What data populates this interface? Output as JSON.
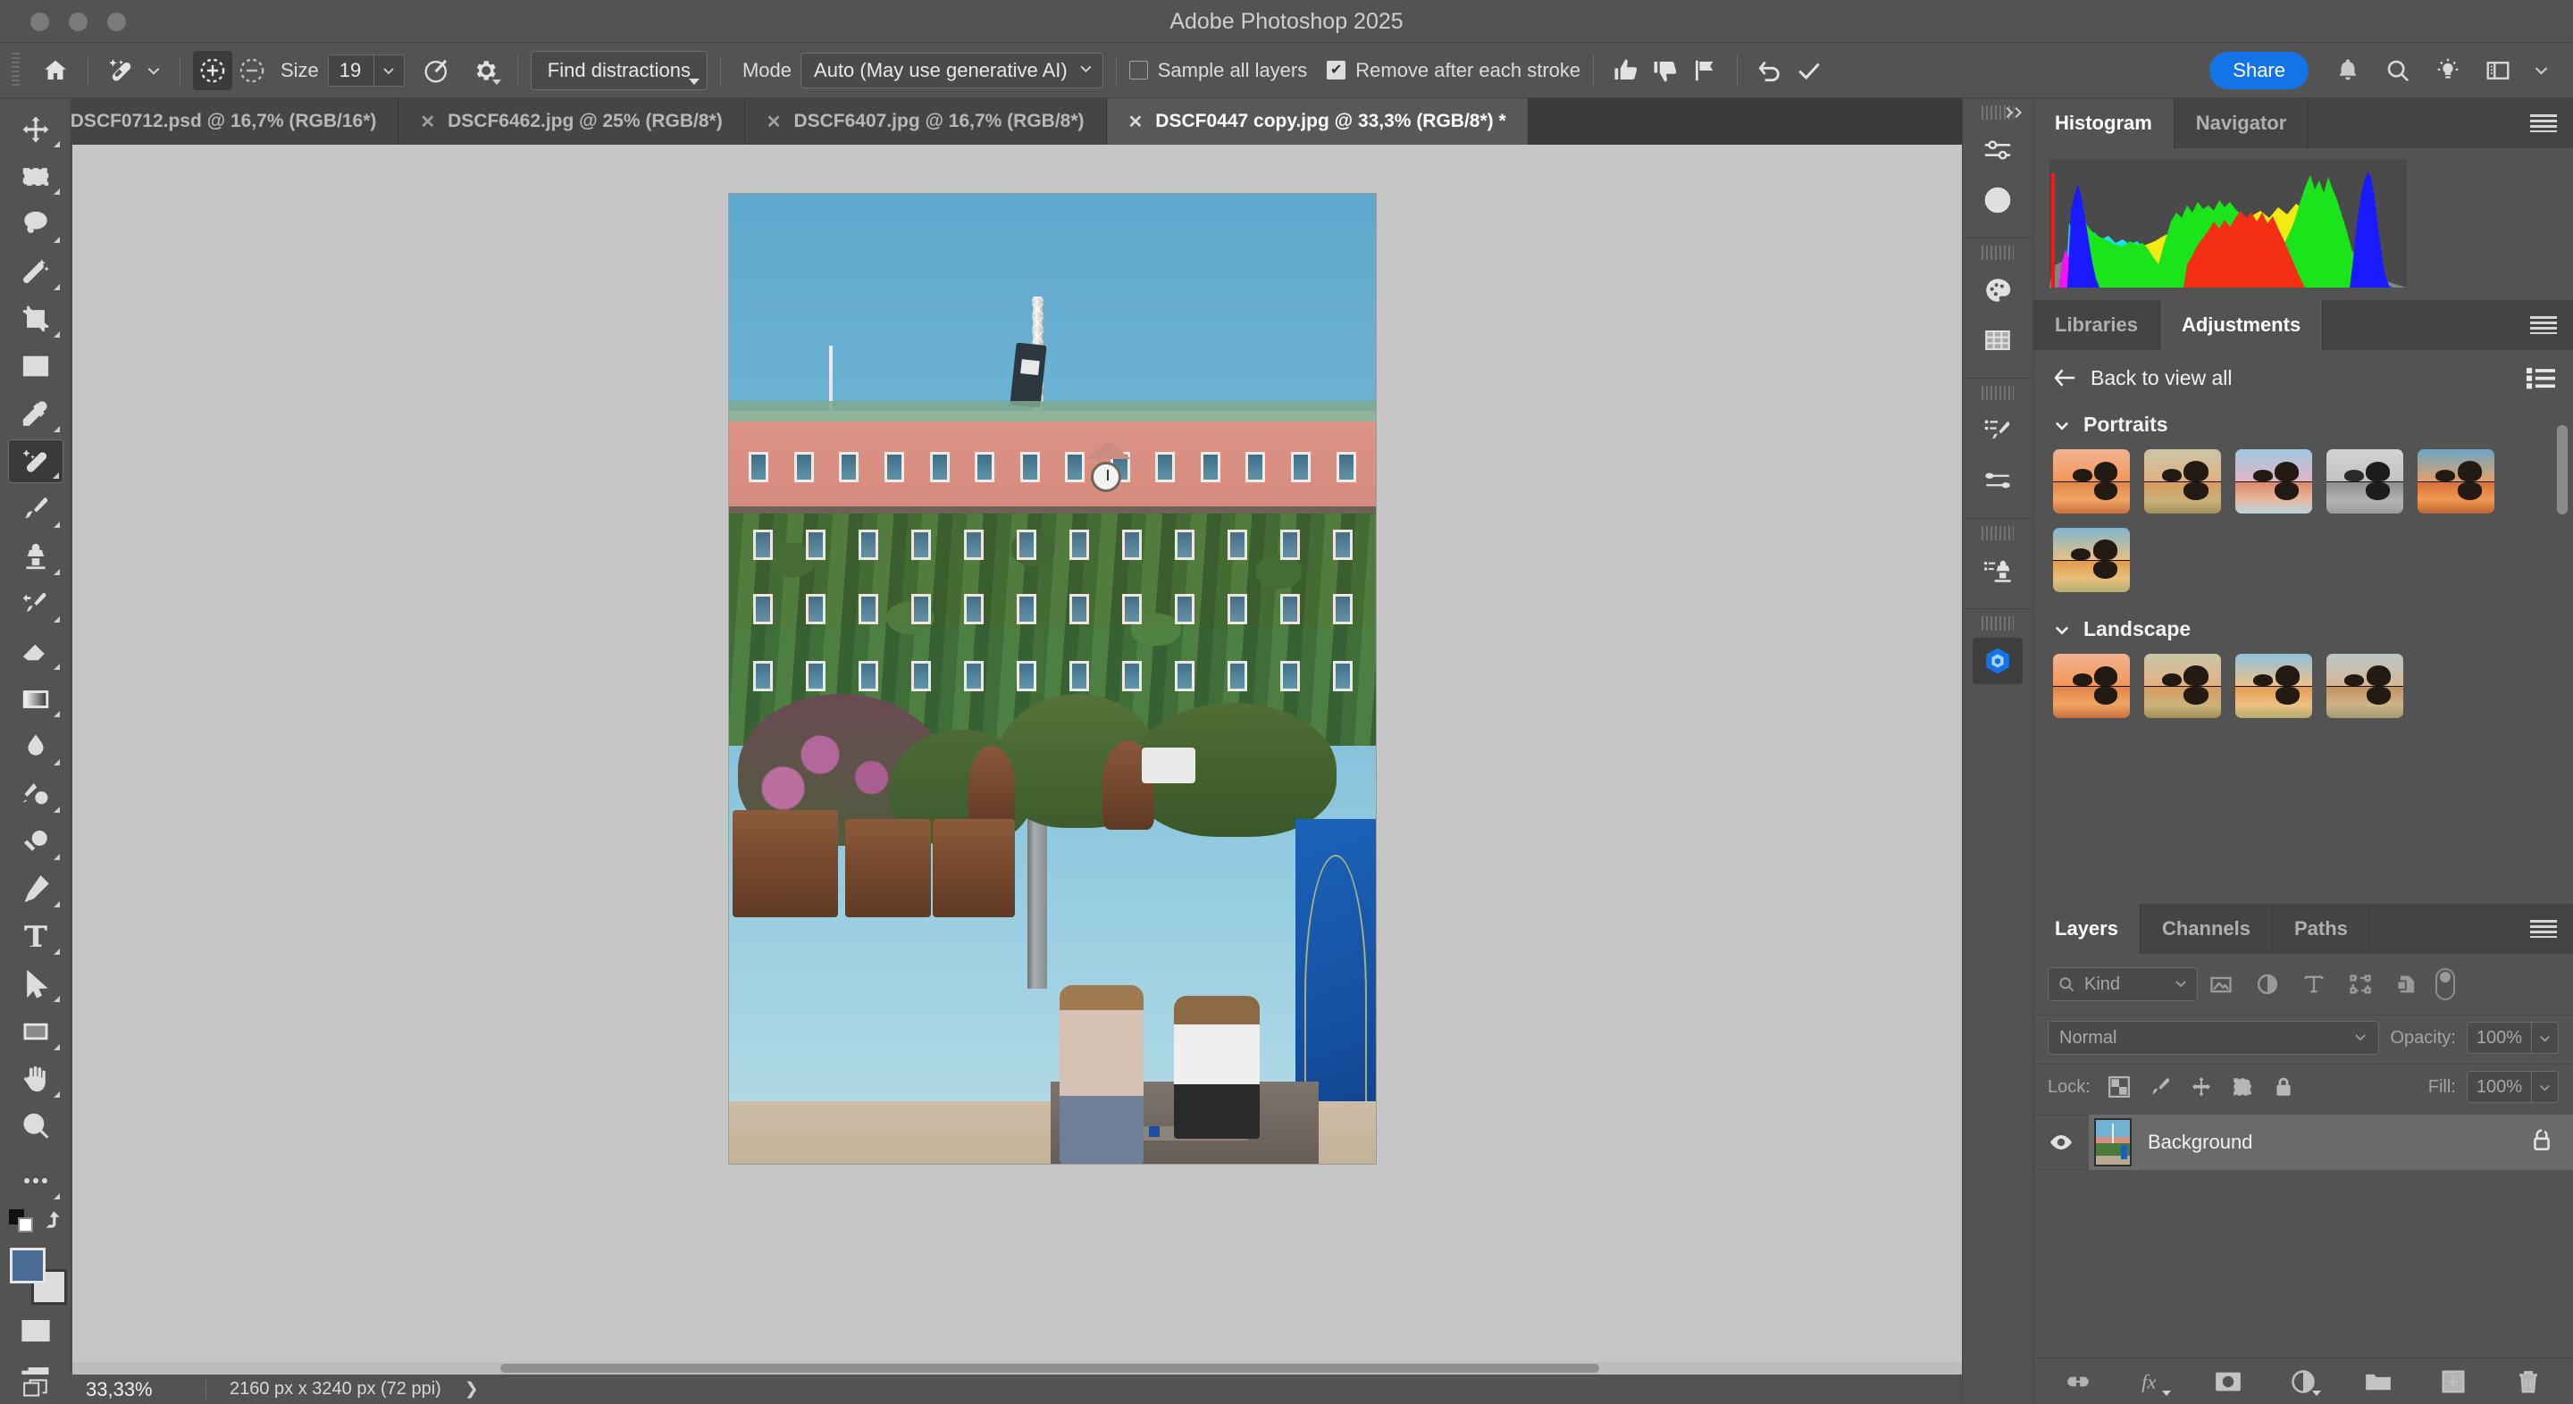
{
  "window": {
    "title": "Adobe Photoshop 2025",
    "traffic_lights": [
      "close",
      "minimize",
      "maximize"
    ]
  },
  "options_bar": {
    "home_icon": "home-icon",
    "tool_preset_icon": "spot-healing-brush-icon",
    "add_to_selection_icon": "add-to-selection-icon",
    "subtract_from_selection_icon": "subtract-from-selection-icon",
    "size_label": "Size",
    "size_value": "19",
    "brush_settings_icon": "brush-settings-icon",
    "gear_icon": "gear-icon",
    "find_distractions_label": "Find distractions",
    "mode_label": "Mode",
    "mode_value": "Auto (May use generative AI)",
    "sample_all_layers_label": "Sample all layers",
    "sample_all_layers_checked": false,
    "remove_after_each_stroke_label": "Remove after each stroke",
    "remove_after_each_stroke_checked": true,
    "thumbs_up_icon": "thumbs-up-icon",
    "thumbs_down_icon": "thumbs-down-icon",
    "flag_icon": "flag-icon",
    "undo_icon": "undo-icon",
    "commit_icon": "checkmark-icon",
    "share_label": "Share",
    "bell_icon": "notifications-bell-icon",
    "search_icon": "search-icon",
    "discover_icon": "lightbulb-icon",
    "workspace_icon": "workspace-panel-icon",
    "workspace_chevron": "chevron-down-icon"
  },
  "tabs": [
    {
      "title": "DSCF0712.psd @ 16,7% (RGB/16*)",
      "active": false
    },
    {
      "title": "DSCF6462.jpg @ 25% (RGB/8*)",
      "active": false
    },
    {
      "title": "DSCF6407.jpg @ 16,7% (RGB/8*)",
      "active": false
    },
    {
      "title": "DSCF0447 copy.jpg @ 33,3% (RGB/8*) *",
      "active": true
    }
  ],
  "toolbar": {
    "tools": [
      {
        "name": "move-tool",
        "icon": "move-icon",
        "has_flyout": true,
        "selected": false
      },
      {
        "name": "rectangular-marquee-tool",
        "icon": "marquee-icon",
        "has_flyout": true,
        "selected": false
      },
      {
        "name": "lasso-tool",
        "icon": "lasso-icon",
        "has_flyout": true,
        "selected": false
      },
      {
        "name": "object-selection-tool",
        "icon": "magic-wand-icon",
        "has_flyout": true,
        "selected": false
      },
      {
        "name": "crop-tool",
        "icon": "crop-icon",
        "has_flyout": true,
        "selected": false
      },
      {
        "name": "frame-tool",
        "icon": "frame-icon",
        "has_flyout": false,
        "selected": false
      },
      {
        "name": "eyedropper-tool",
        "icon": "eyedropper-icon",
        "has_flyout": true,
        "selected": false
      },
      {
        "name": "spot-healing-brush-tool",
        "icon": "healing-brush-icon",
        "has_flyout": true,
        "selected": true
      },
      {
        "name": "brush-tool",
        "icon": "brush-icon",
        "has_flyout": true,
        "selected": false
      },
      {
        "name": "clone-stamp-tool",
        "icon": "clone-stamp-icon",
        "has_flyout": true,
        "selected": false
      },
      {
        "name": "history-brush-tool",
        "icon": "history-brush-icon",
        "has_flyout": true,
        "selected": false
      },
      {
        "name": "eraser-tool",
        "icon": "eraser-icon",
        "has_flyout": true,
        "selected": false
      },
      {
        "name": "gradient-tool",
        "icon": "gradient-icon",
        "has_flyout": true,
        "selected": false
      },
      {
        "name": "blur-tool",
        "icon": "blur-droplet-icon",
        "has_flyout": true,
        "selected": false
      },
      {
        "name": "dodge-tool",
        "icon": "dodge-burn-icon",
        "has_flyout": true,
        "selected": false
      },
      {
        "name": "dodge-sponge-tool",
        "icon": "dodge-icon",
        "has_flyout": true,
        "selected": false
      },
      {
        "name": "pen-tool",
        "icon": "pen-icon",
        "has_flyout": true,
        "selected": false
      },
      {
        "name": "type-tool",
        "icon": "type-icon",
        "has_flyout": true,
        "selected": false
      },
      {
        "name": "path-selection-tool",
        "icon": "path-arrow-icon",
        "has_flyout": true,
        "selected": false
      },
      {
        "name": "rectangle-tool",
        "icon": "rectangle-icon",
        "has_flyout": true,
        "selected": false
      },
      {
        "name": "hand-tool",
        "icon": "hand-icon",
        "has_flyout": true,
        "selected": false
      },
      {
        "name": "zoom-tool",
        "icon": "zoom-magnifier-icon",
        "has_flyout": false,
        "selected": false
      },
      {
        "name": "edit-toolbar",
        "icon": "more-ellipsis-icon",
        "has_flyout": true,
        "selected": false
      }
    ],
    "default_colors_icon": "default-colors-icon",
    "swap_colors_icon": "swap-colors-icon",
    "foreground_color": "#4a6b96",
    "background_color": "#dcdcdc",
    "quick_mask_icon": "quick-mask-icon",
    "screen_mode_icon": "screen-mode-icon"
  },
  "rail": {
    "groups": [
      {
        "icons": [
          "adjustments-sliders-icon",
          "info-icon"
        ]
      },
      {
        "icons": [
          "color-palette-icon",
          "swatches-grid-icon"
        ]
      },
      {
        "icons": [
          "brush-presets-icon",
          "brush-settings-sliders-icon"
        ]
      },
      {
        "icons": [
          "clone-source-icon"
        ]
      },
      {
        "icons": [
          "adobe-firefly-icon"
        ]
      }
    ]
  },
  "histogram_panel": {
    "tabs": [
      {
        "label": "Histogram",
        "active": true
      },
      {
        "label": "Navigator",
        "active": false
      }
    ],
    "menu_icon": "panel-menu-icon",
    "warning_icon": "uncached-data-warning-icon"
  },
  "adjustments_panel": {
    "tabs": [
      {
        "label": "Libraries",
        "active": false
      },
      {
        "label": "Adjustments",
        "active": true
      }
    ],
    "menu_icon": "panel-menu-icon",
    "back_arrow_icon": "back-arrow-icon",
    "back_label": "Back to view all",
    "list_view_icon": "list-view-icon",
    "sections": [
      {
        "name": "Portraits",
        "chevron": "chevron-down-icon",
        "presets": [
          {
            "name": "portrait-preset-1",
            "tone": "warm"
          },
          {
            "name": "portrait-preset-2",
            "tone": "warm-soft"
          },
          {
            "name": "portrait-preset-3",
            "tone": "cool-pink"
          },
          {
            "name": "portrait-preset-4",
            "tone": "black-white"
          },
          {
            "name": "portrait-preset-5",
            "tone": "warm-deep"
          },
          {
            "name": "portrait-preset-6",
            "tone": "golden"
          }
        ]
      },
      {
        "name": "Landscape",
        "chevron": "chevron-down-icon",
        "presets": [
          {
            "name": "landscape-preset-1",
            "tone": "warm"
          },
          {
            "name": "landscape-preset-2",
            "tone": "warm-soft"
          },
          {
            "name": "landscape-preset-3",
            "tone": "golden"
          },
          {
            "name": "landscape-preset-4",
            "tone": "muted"
          }
        ]
      }
    ]
  },
  "layers_panel": {
    "tabs": [
      {
        "label": "Layers",
        "active": true
      },
      {
        "label": "Channels",
        "active": false
      },
      {
        "label": "Paths",
        "active": false
      }
    ],
    "menu_icon": "panel-menu-icon",
    "filter": {
      "search_icon": "search-icon",
      "kind_label": "Kind",
      "chevron": "chevron-down-icon",
      "filter_icons": [
        "filter-pixel-icon",
        "filter-adjustment-icon",
        "filter-type-icon",
        "filter-shape-icon",
        "filter-smart-object-icon"
      ],
      "enable_filter_toggle": "filter-toggle-switch"
    },
    "blend_mode": "Normal",
    "blend_chevron": "chevron-down-icon",
    "opacity_label": "Opacity:",
    "opacity_value": "100%",
    "lock_label": "Lock:",
    "lock_icons": [
      "lock-transparent-pixels-icon",
      "lock-image-pixels-icon",
      "lock-position-icon",
      "lock-artboard-nesting-icon",
      "lock-all-icon"
    ],
    "fill_label": "Fill:",
    "fill_value": "100%",
    "layers": [
      {
        "name": "Background",
        "visible": true,
        "visibility_icon": "eye-icon",
        "locked": true,
        "lock_icon": "lock-icon",
        "selected": true
      }
    ],
    "footer_icons": [
      "link-layers-icon",
      "add-layer-style-fx-icon",
      "add-layer-mask-icon",
      "new-adjustment-layer-icon",
      "new-group-icon",
      "new-layer-icon",
      "delete-layer-icon"
    ]
  },
  "canvas": {
    "document_name": "DSCF0447 copy.jpg",
    "image_alt": "Outdoor city square with canopy, flagpole mast, pink ivy-covered building and two people at a foosball table"
  },
  "status_bar": {
    "screen_mode_icon": "screen-mode-icon",
    "zoom_level": "33,33%",
    "doc_dimensions": "2160 px x 3240 px (72 ppi)",
    "expand_arrow": "chevron-right-icon"
  },
  "colors": {
    "accent_blue": "#1473e6",
    "chrome_bg": "#535353",
    "panel_bg": "#535353",
    "tab_inactive": "#454545",
    "canvas_bg": "#c6c6c6",
    "selected_layer": "#6a6a6a"
  }
}
